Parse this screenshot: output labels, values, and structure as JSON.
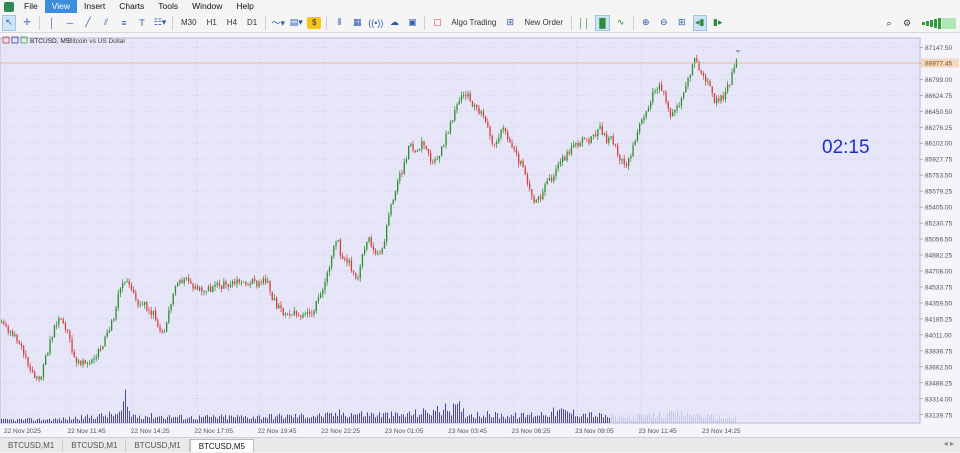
{
  "menu": [
    "File",
    "View",
    "Insert",
    "Charts",
    "Tools",
    "Window",
    "Help"
  ],
  "menu_active": "View",
  "toolbar": {
    "timeframes": [
      "M30",
      "H1",
      "H4",
      "D1"
    ],
    "algo_trading": "Algo Trading",
    "new_order": "New Order"
  },
  "chart": {
    "header_symbol": "BTCUSD, M5:",
    "header_desc": "Bitcoin vs US Dollar",
    "timer": "02:15",
    "current_price_label": "86977.45",
    "colors": {
      "bg": "#e6e6f8",
      "bull": "#2e8b2e",
      "bear": "#d43c3c",
      "volume": "#3a3a8c",
      "timer": "#1a2fd0",
      "price_line": "#e0b080"
    }
  },
  "chart_data": {
    "type": "candlestick",
    "symbol": "BTCUSD",
    "timeframe": "M5",
    "y_ticks": [
      "87147.50",
      "86973.25",
      "86799.00",
      "86624.75",
      "86450.50",
      "86276.25",
      "86102.00",
      "85927.75",
      "85753.50",
      "85579.25",
      "85405.00",
      "85230.75",
      "85056.50",
      "84882.25",
      "84708.00",
      "84533.75",
      "84359.50",
      "84185.25",
      "84011.00",
      "83836.75",
      "83662.50",
      "83488.25",
      "83314.00",
      "83139.75"
    ],
    "ylim": [
      83050,
      87250
    ],
    "x_ticks": [
      "22 Nov 2025",
      "22 Nov 11:45",
      "22 Nov 14:25",
      "22 Nov 17:05",
      "22 Nov 19:45",
      "22 Nov 22:25",
      "23 Nov 01:05",
      "23 Nov 03:45",
      "23 Nov 06:25",
      "23 Nov 09:05",
      "23 Nov 11:45",
      "23 Nov 14:25"
    ],
    "path": [
      [
        0,
        84150
      ],
      [
        5,
        84080
      ],
      [
        14,
        83980
      ],
      [
        22,
        83850
      ],
      [
        30,
        83650
      ],
      [
        38,
        83520
      ],
      [
        44,
        83700
      ],
      [
        50,
        83950
      ],
      [
        57,
        84180
      ],
      [
        62,
        84200
      ],
      [
        68,
        84000
      ],
      [
        74,
        83760
      ],
      [
        80,
        83680
      ],
      [
        88,
        83720
      ],
      [
        96,
        83800
      ],
      [
        104,
        83950
      ],
      [
        112,
        84150
      ],
      [
        118,
        84500
      ],
      [
        124,
        84620
      ],
      [
        130,
        84500
      ],
      [
        138,
        84350
      ],
      [
        146,
        84320
      ],
      [
        155,
        84200
      ],
      [
        160,
        84050
      ],
      [
        165,
        84100
      ],
      [
        172,
        84450
      ],
      [
        178,
        84560
      ],
      [
        184,
        84650
      ],
      [
        190,
        84560
      ],
      [
        198,
        84520
      ],
      [
        206,
        84500
      ],
      [
        214,
        84540
      ],
      [
        222,
        84560
      ],
      [
        230,
        84580
      ],
      [
        238,
        84620
      ],
      [
        244,
        84560
      ],
      [
        250,
        84600
      ],
      [
        256,
        84580
      ],
      [
        262,
        84620
      ],
      [
        268,
        84560
      ],
      [
        272,
        84400
      ],
      [
        278,
        84300
      ],
      [
        285,
        84200
      ],
      [
        292,
        84250
      ],
      [
        300,
        84200
      ],
      [
        310,
        84250
      ],
      [
        318,
        84380
      ],
      [
        325,
        84600
      ],
      [
        332,
        84950
      ],
      [
        336,
        85080
      ],
      [
        340,
        84900
      ],
      [
        346,
        84850
      ],
      [
        352,
        84700
      ],
      [
        358,
        84650
      ],
      [
        362,
        84900
      ],
      [
        368,
        85050
      ],
      [
        374,
        84950
      ],
      [
        380,
        84850
      ],
      [
        386,
        85200
      ],
      [
        392,
        85500
      ],
      [
        398,
        85700
      ],
      [
        404,
        85900
      ],
      [
        410,
        86100
      ],
      [
        416,
        86000
      ],
      [
        422,
        86150
      ],
      [
        426,
        86050
      ],
      [
        432,
        85850
      ],
      [
        438,
        85950
      ],
      [
        444,
        86150
      ],
      [
        450,
        86300
      ],
      [
        456,
        86500
      ],
      [
        462,
        86650
      ],
      [
        468,
        86620
      ],
      [
        474,
        86500
      ],
      [
        480,
        86450
      ],
      [
        486,
        86300
      ],
      [
        492,
        86050
      ],
      [
        498,
        86200
      ],
      [
        504,
        86250
      ],
      [
        510,
        86100
      ],
      [
        516,
        85950
      ],
      [
        522,
        85850
      ],
      [
        528,
        85600
      ],
      [
        534,
        85450
      ],
      [
        540,
        85500
      ],
      [
        546,
        85650
      ],
      [
        552,
        85750
      ],
      [
        558,
        85900
      ],
      [
        564,
        85950
      ],
      [
        570,
        86050
      ],
      [
        576,
        86100
      ],
      [
        582,
        86150
      ],
      [
        588,
        86100
      ],
      [
        594,
        86200
      ],
      [
        600,
        86250
      ],
      [
        606,
        86150
      ],
      [
        612,
        86150
      ],
      [
        618,
        85950
      ],
      [
        624,
        85850
      ],
      [
        630,
        86000
      ],
      [
        636,
        86200
      ],
      [
        642,
        86350
      ],
      [
        648,
        86500
      ],
      [
        654,
        86700
      ],
      [
        658,
        86750
      ],
      [
        664,
        86600
      ],
      [
        670,
        86400
      ],
      [
        676,
        86500
      ],
      [
        682,
        86600
      ],
      [
        688,
        86850
      ],
      [
        694,
        87000
      ],
      [
        700,
        86900
      ],
      [
        706,
        86780
      ],
      [
        712,
        86600
      ],
      [
        718,
        86550
      ],
      [
        724,
        86650
      ],
      [
        730,
        86800
      ],
      [
        736,
        86977
      ]
    ],
    "volume_profile": [
      [
        0,
        0.12
      ],
      [
        60,
        0.15
      ],
      [
        120,
        0.35
      ],
      [
        125,
        0.9
      ],
      [
        130,
        0.3
      ],
      [
        190,
        0.22
      ],
      [
        260,
        0.25
      ],
      [
        330,
        0.3
      ],
      [
        340,
        0.38
      ],
      [
        400,
        0.3
      ],
      [
        460,
        0.6
      ],
      [
        465,
        0.35
      ],
      [
        520,
        0.28
      ],
      [
        560,
        0.45
      ],
      [
        620,
        0.2
      ],
      [
        680,
        0.35
      ],
      [
        737,
        0.15
      ]
    ],
    "x_extent": 737
  }
}
